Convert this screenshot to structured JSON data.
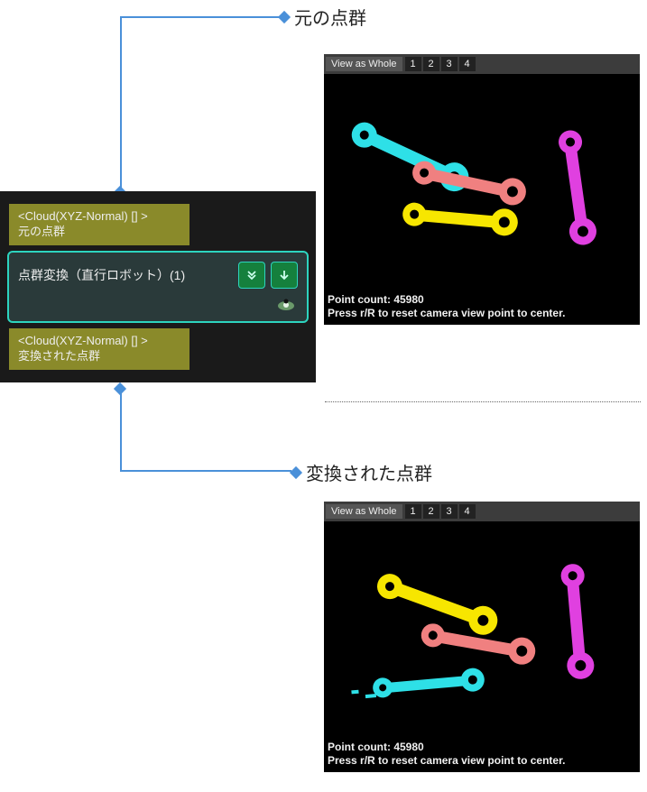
{
  "labels": {
    "original": "元の点群",
    "transformed": "変換された点群"
  },
  "node": {
    "input_port_type": "<Cloud(XYZ-Normal) [] >",
    "input_port_name": "元の点群",
    "title": "点群変換（直行ロボット）(1)",
    "output_port_type": "<Cloud(XYZ-Normal) [] >",
    "output_port_name": "変換された点群"
  },
  "viewer": {
    "view_mode": "View as Whole",
    "page_numbers": [
      "1",
      "2",
      "3",
      "4"
    ],
    "point_count_label": "Point count:",
    "point_count_value": "45980",
    "reset_hint": "Press r/R to reset camera view point to center."
  },
  "colors": {
    "cyan": "#2ee0e7",
    "salmon": "#f08080",
    "yellow": "#f7e600",
    "magenta": "#e040e0",
    "connector": "#4A90D9"
  }
}
